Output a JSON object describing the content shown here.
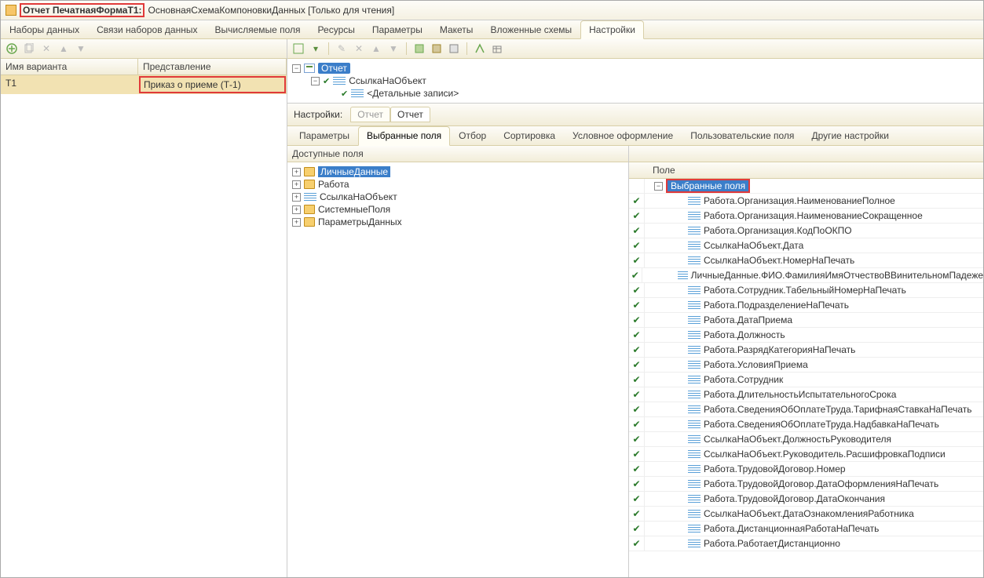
{
  "title": {
    "main": "Отчет ПечатнаяФормаТ1:",
    "sub": "ОсновнаяСхемаКомпоновкиДанных [Только для чтения]"
  },
  "maintabs": [
    "Наборы данных",
    "Связи наборов данных",
    "Вычисляемые поля",
    "Ресурсы",
    "Параметры",
    "Макеты",
    "Вложенные схемы",
    "Настройки"
  ],
  "maintab_active": 7,
  "left": {
    "headers": {
      "variant": "Имя варианта",
      "presentation": "Представление"
    },
    "row": {
      "name": "Т1",
      "presentation": "Приказ о приеме (Т-1)"
    }
  },
  "tree": {
    "root": "Отчет",
    "child1": "СсылкаНаОбъект",
    "child2": "<Детальные записи>"
  },
  "settings_label": "Настройки:",
  "settings_tabs": [
    "Отчет",
    "Отчет"
  ],
  "settings_tab_active": 1,
  "subtabs": [
    "Параметры",
    "Выбранные поля",
    "Отбор",
    "Сортировка",
    "Условное оформление",
    "Пользовательские поля",
    "Другие настройки"
  ],
  "subtab_active": 1,
  "available_header": "Доступные поля",
  "available": [
    {
      "icon": "folder",
      "label": "ЛичныеДанные",
      "selected": true
    },
    {
      "icon": "folder",
      "label": "Работа"
    },
    {
      "icon": "lines",
      "label": "СсылкаНаОбъект"
    },
    {
      "icon": "folder",
      "label": "СистемныеПоля"
    },
    {
      "icon": "folder",
      "label": "ПараметрыДанных"
    }
  ],
  "field_header": "Поле",
  "fields_group": "Выбранные поля",
  "fields": [
    "Работа.Организация.НаименованиеПолное",
    "Работа.Организация.НаименованиеСокращенное",
    "Работа.Организация.КодПоОКПО",
    "СсылкаНаОбъект.Дата",
    "СсылкаНаОбъект.НомерНаПечать",
    "ЛичныеДанные.ФИО.ФамилияИмяОтчествоВВинительномПадеже",
    "Работа.Сотрудник.ТабельныйНомерНаПечать",
    "Работа.ПодразделениеНаПечать",
    "Работа.ДатаПриема",
    "Работа.Должность",
    "Работа.РазрядКатегорияНаПечать",
    "Работа.УсловияПриема",
    "Работа.Сотрудник",
    "Работа.ДлительностьИспытательногоСрока",
    "Работа.СведенияОбОплатеТруда.ТарифнаяСтавкаНаПечать",
    "Работа.СведенияОбОплатеТруда.НадбавкаНаПечать",
    "СсылкаНаОбъект.ДолжностьРуководителя",
    "СсылкаНаОбъект.Руководитель.РасшифровкаПодписи",
    "Работа.ТрудовойДоговор.Номер",
    "Работа.ТрудовойДоговор.ДатаОформленияНаПечать",
    "Работа.ТрудовойДоговор.ДатаОкончания",
    "СсылкаНаОбъект.ДатаОзнакомленияРаботника",
    "Работа.ДистанционнаяРаботаНаПечать",
    "Работа.РаботаетДистанционно"
  ]
}
